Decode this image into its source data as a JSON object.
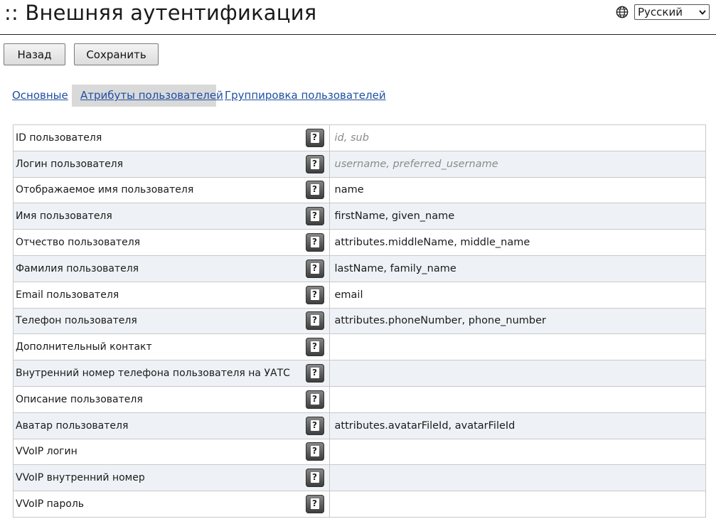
{
  "page": {
    "title": ":: Внешняя аутентификация"
  },
  "language": {
    "selected": "Русский",
    "icon": "globe-icon"
  },
  "toolbar": {
    "back_label": "Назад",
    "save_label": "Сохранить"
  },
  "tabs": [
    {
      "label": "Основные",
      "active": false
    },
    {
      "label": "Атрибуты пользователей",
      "active": true
    },
    {
      "label": "Группировка пользователей",
      "active": false
    }
  ],
  "help_icon_glyph": "?",
  "attributes": [
    {
      "label": "ID пользователя",
      "value": "",
      "placeholder": "id, sub"
    },
    {
      "label": "Логин пользователя",
      "value": "",
      "placeholder": "username, preferred_username"
    },
    {
      "label": "Отображаемое имя пользователя",
      "value": "name",
      "placeholder": ""
    },
    {
      "label": "Имя пользователя",
      "value": "firstName, given_name",
      "placeholder": ""
    },
    {
      "label": "Отчество пользователя",
      "value": "attributes.middleName, middle_name",
      "placeholder": ""
    },
    {
      "label": "Фамилия пользователя",
      "value": "lastName, family_name",
      "placeholder": ""
    },
    {
      "label": "Email пользователя",
      "value": "email",
      "placeholder": ""
    },
    {
      "label": "Телефон пользователя",
      "value": "attributes.phoneNumber, phone_number",
      "placeholder": ""
    },
    {
      "label": "Дополнительный контакт",
      "value": "",
      "placeholder": ""
    },
    {
      "label": "Внутренний номер телефона пользователя на УАТС",
      "value": "",
      "placeholder": ""
    },
    {
      "label": "Описание пользователя",
      "value": "",
      "placeholder": ""
    },
    {
      "label": "Аватар пользователя",
      "value": "attributes.avatarFileId, avatarFileId",
      "placeholder": ""
    },
    {
      "label": "VVoIP логин",
      "value": "",
      "placeholder": ""
    },
    {
      "label": "VVoIP внутренний номер",
      "value": "",
      "placeholder": ""
    },
    {
      "label": "VVoIP пароль",
      "value": "",
      "placeholder": ""
    }
  ]
}
